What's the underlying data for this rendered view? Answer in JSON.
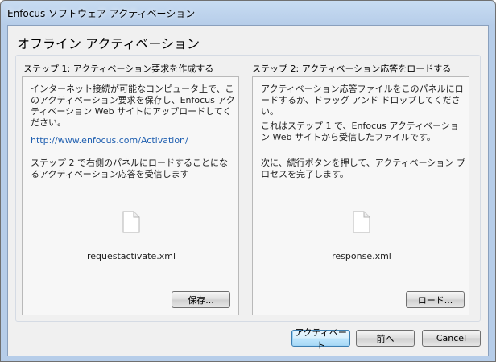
{
  "window": {
    "title": "Enfocus ソフトウェア アクティベーション"
  },
  "page": {
    "title": "オフライン アクティベーション"
  },
  "step1": {
    "heading": "ステップ 1: アクティベーション要求を作成する",
    "para1": "インターネット接続が可能なコンピュータ上で、このアクティベーション要求を保存し、Enfocus アクティベーション Web サイトにアップロードしてください。",
    "link": "http://www.enfocus.com/Activation/",
    "para2": "ステップ 2 で右側のパネルにロードすることになるアクティベーション応答を受信します",
    "file_name": "requestactivate.xml",
    "save_label": "保存..."
  },
  "step2": {
    "heading": "ステップ 2: アクティベーション応答をロードする",
    "para1": "アクティベーション応答ファイルをこのパネルにロードするか、ドラッグ アンド ドロップしてください。",
    "para2": "これはステップ 1 で、Enfocus アクティベーション Web サイトから受信したファイルです。",
    "para3": "次に、続行ボタンを押して、アクティベーション プロセスを完了します。",
    "file_name": "response.xml",
    "load_label": "ロード..."
  },
  "footer": {
    "activate_label": "アクティベート",
    "back_label": "前へ",
    "cancel_label": "Cancel"
  }
}
